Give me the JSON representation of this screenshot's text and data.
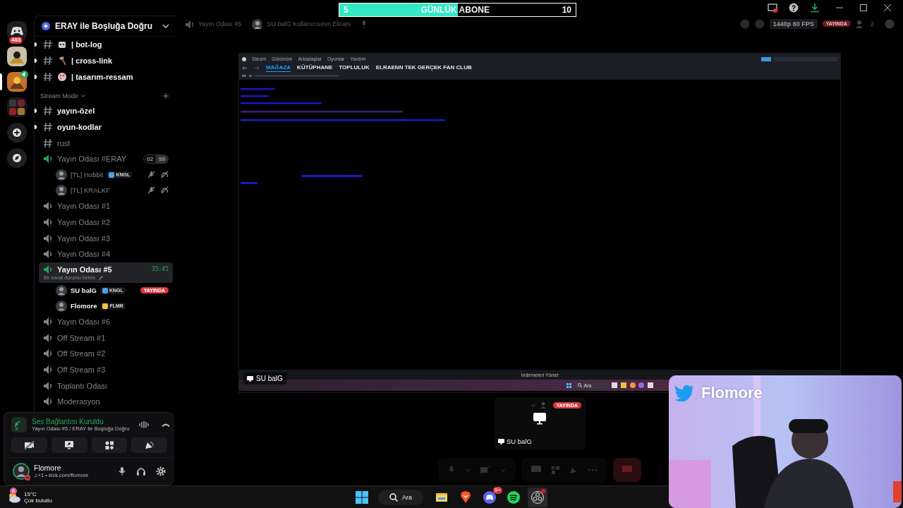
{
  "goal_bar": {
    "current": "5",
    "label": "GÜNLÜK ABONE",
    "target": "10",
    "level": 0.5
  },
  "server_rail": {
    "home_badge": "483",
    "servers": [
      {
        "kind": "picture",
        "selected": false,
        "in_voice": false
      },
      {
        "kind": "picture",
        "selected": true,
        "in_voice": true
      },
      {
        "kind": "folder",
        "selected": false,
        "in_voice": false
      }
    ]
  },
  "server": {
    "name": "ERAY ile Boşluğa Doğru"
  },
  "channels": [
    {
      "kind": "robot-text",
      "name": "| bot-log",
      "unread": true
    },
    {
      "kind": "hammer-text",
      "name": "| cross-link",
      "unread": true
    },
    {
      "kind": "palette-text",
      "name": "| tasarım-ressam",
      "unread": true
    },
    {
      "kind": "category",
      "name": "Stream Mode"
    },
    {
      "kind": "text",
      "name": "yayın-özel",
      "unread": true
    },
    {
      "kind": "text",
      "name": "oyun-kodlar",
      "unread": true
    },
    {
      "kind": "text",
      "name": "rust",
      "unread": false
    },
    {
      "kind": "voice",
      "name": "Yayın Odası #ERAY",
      "active": true,
      "selected": false,
      "counts": [
        "02",
        "99"
      ],
      "members": [
        {
          "name": "[TL] Hobbit",
          "tag": "KNGL",
          "muted": true,
          "deafened": true
        },
        {
          "name": "[TL] KRALKF",
          "muted": true,
          "deafened": true
        }
      ]
    },
    {
      "kind": "voice",
      "name": "Yayın Odası #1",
      "active": false,
      "selected": false
    },
    {
      "kind": "voice",
      "name": "Yayın Odası #2",
      "active": false,
      "selected": false
    },
    {
      "kind": "voice",
      "name": "Yayın Odası #3",
      "active": false,
      "selected": false
    },
    {
      "kind": "voice",
      "name": "Yayın Odası #4",
      "active": false,
      "selected": false
    },
    {
      "kind": "voice",
      "name": "Yayın Odası #5",
      "active": true,
      "selected": true,
      "timer": "35:45",
      "status": "Bir kanal durumu belirle",
      "members": [
        {
          "name": "SU balG",
          "tag": "KNGL",
          "live": "YAYINDA",
          "muted": false,
          "deafened": false
        },
        {
          "name": "Flomore",
          "tag": "FLMR",
          "muted": false,
          "deafened": false
        }
      ]
    },
    {
      "kind": "voice",
      "name": "Yayın Odası #6",
      "active": false,
      "selected": false
    },
    {
      "kind": "voice",
      "name": "Off Stream #1",
      "active": false,
      "selected": false
    },
    {
      "kind": "voice",
      "name": "Off Stream #2",
      "active": false,
      "selected": false
    },
    {
      "kind": "voice",
      "name": "Off Stream #3",
      "active": false,
      "selected": false
    },
    {
      "kind": "voice",
      "name": "Toplantı Odası",
      "active": false,
      "selected": false
    },
    {
      "kind": "voice",
      "name": "Moderasyon",
      "active": false,
      "selected": false
    }
  ],
  "voice_panel": {
    "status": "Ses Bağlantısı Kuruldu",
    "location": "Yayın Odası #5 / ERAY ile Boşluğa Doğru"
  },
  "user": {
    "name": "Flomore",
    "activity": "♫+1 • kick.com/flomore"
  },
  "stream_bar": {
    "channel": "Yayın Odası #5",
    "title": "SU balG Kullanıcısının Ekranı",
    "quality": "1440p 60 FPS",
    "live": "YAYINDA",
    "viewers": "2"
  },
  "stream": {
    "menu": [
      "Steam",
      "Görünüm",
      "Arkadaşlar",
      "Oyunlar",
      "Yardım"
    ],
    "nav": [
      {
        "label": "MAĞAZA",
        "selected": true
      },
      {
        "label": "KÜTÜPHANE",
        "selected": false
      },
      {
        "label": "TOPLULUK",
        "selected": false
      },
      {
        "label": "ELRAENN TEK GERÇEK FAN CLUB",
        "selected": false
      }
    ],
    "inner_title": "İndirmeleri Yönet",
    "streamer": "SU balG",
    "inner_search": "Ara"
  },
  "tile": {
    "live": "YAYINDA",
    "name": "SU balG"
  },
  "webcam": {
    "handle": "Flomore"
  },
  "taskbar": {
    "weather": {
      "badge": "6",
      "temp": "15°C",
      "condition": "Çok bulutlu"
    },
    "search": "Ara",
    "apps": [
      {
        "kind": "files",
        "selected": false
      },
      {
        "kind": "brave",
        "selected": false
      },
      {
        "kind": "discord",
        "badge": "9+",
        "selected": false
      },
      {
        "kind": "spotify",
        "selected": false
      },
      {
        "kind": "obs",
        "selected": true
      }
    ]
  }
}
